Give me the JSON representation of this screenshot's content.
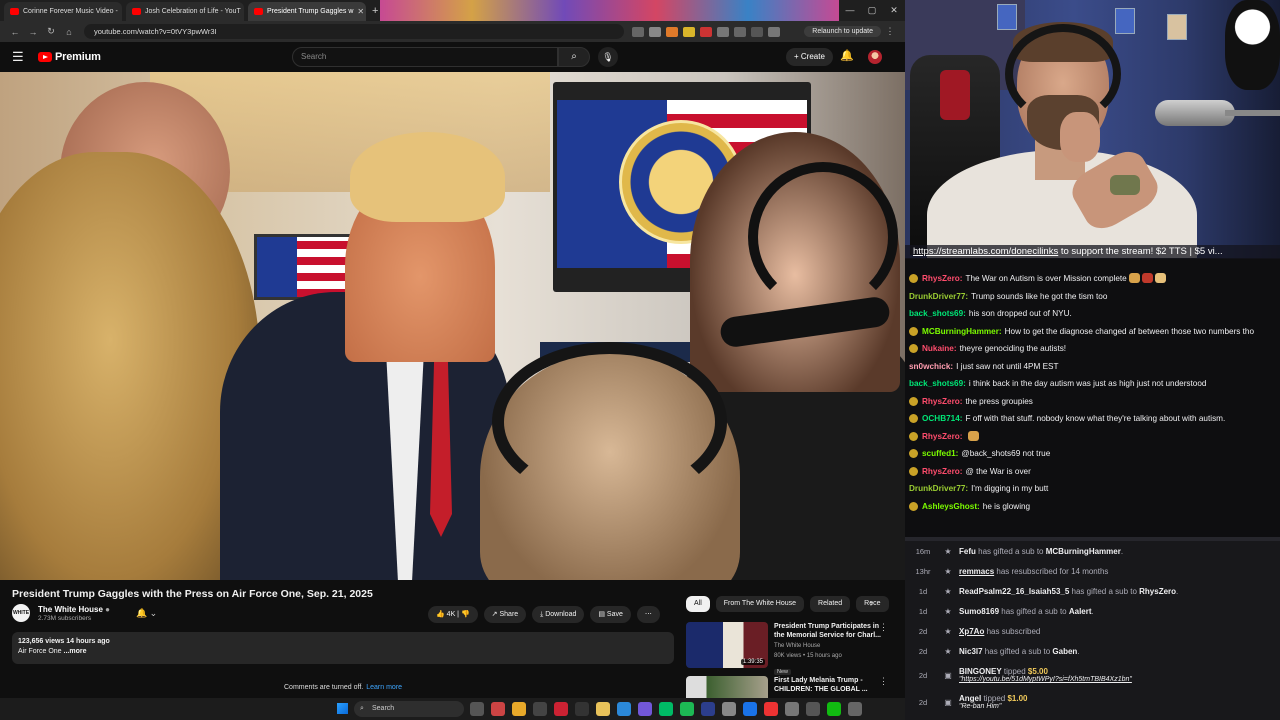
{
  "browser": {
    "tabs": [
      {
        "label": "Corinne Forever Music Video -",
        "active": false
      },
      {
        "label": "Josh Celebration of Life - YouT",
        "active": false
      },
      {
        "label": "President Trump Gaggles w",
        "active": true
      }
    ],
    "url": "youtube.com/watch?v=0tVY3pwWr3I",
    "relaunch_label": "Relaunch to update"
  },
  "youtube": {
    "brand": "Premium",
    "search_placeholder": "Search",
    "create_label": "Create",
    "video_title": "President Trump Gaggles with the Press on Air Force One, Sep. 21, 2025",
    "channel_name": "The White House",
    "channel_avatar_text": "WHITE HOUSE",
    "subscribers": "2.73M subscribers",
    "actions": {
      "likes": "4K",
      "share": "Share",
      "download": "Download",
      "save": "Save"
    },
    "description": {
      "stats": "123,656 views  14 hours ago",
      "text": "Air Force One",
      "more": "...more"
    },
    "comments_off": "Comments are turned off.",
    "learn_more": "Learn more",
    "chips": [
      "All",
      "From The White House",
      "Related",
      "Rece"
    ],
    "related": [
      {
        "title": "President Trump Participates in the Memorial Service for Charl...",
        "channel": "The White House",
        "meta": "80K views • 15 hours ago",
        "badge": "New",
        "duration": "1:39:35"
      },
      {
        "title": "First Lady Melania Trump - CHILDREN: THE GLOBAL ...",
        "channel": "",
        "meta": "",
        "badge": "",
        "duration": ""
      }
    ]
  },
  "stream": {
    "banner_link": "https://streamlabs.com/donecilinks",
    "banner_text": " to support the stream! $2 TTS | $5 vi..."
  },
  "chat": [
    {
      "user": "RhysZero",
      "color": "#ff4d6d",
      "text": "The War on Autism is over Mission complete",
      "badge": "#c9a227",
      "emotes": 3
    },
    {
      "user": "DrunkDriver77",
      "color": "#9acd32",
      "text": "Trump sounds like he got the tism too",
      "badge": "",
      "emotes": 0
    },
    {
      "user": "back_shots69",
      "color": "#00e676",
      "text": "his son dropped out of NYU.",
      "badge": "",
      "emotes": 0
    },
    {
      "user": "MCBurningHammer",
      "color": "#7cfc00",
      "text": "How to get the diagnose changed af between those two numbers tho",
      "badge": "#c9a227",
      "emotes": 0
    },
    {
      "user": "Nukaine",
      "color": "#ff4d6d",
      "text": "theyre genociding the autists!",
      "badge": "#c9a227",
      "emotes": 0
    },
    {
      "user": "sn0wchick",
      "color": "#ff9db0",
      "text": "I just saw not until 4PM EST",
      "badge": "",
      "emotes": 0
    },
    {
      "user": "back_shots69",
      "color": "#00e676",
      "text": "i think back in the day autism was just as high just not understood",
      "badge": "",
      "emotes": 0
    },
    {
      "user": "RhysZero",
      "color": "#ff4d6d",
      "text": "the press groupies",
      "badge": "#c9a227",
      "emotes": 0
    },
    {
      "user": "OCHB714",
      "color": "#00e676",
      "text": "F off with that stuff. nobody know what they're talking about with autism.",
      "badge": "#c9a227",
      "emotes": 0
    },
    {
      "user": "RhysZero",
      "color": "#ff4d6d",
      "text": "",
      "badge": "#c9a227",
      "emotes": 1
    },
    {
      "user": "scuffed1",
      "color": "#7cfc00",
      "text": "@back_shots69 not true",
      "badge": "#c9a227",
      "emotes": 0
    },
    {
      "user": "RhysZero",
      "color": "#ff4d6d",
      "text": "@ the War is over",
      "badge": "#c9a227",
      "emotes": 0
    },
    {
      "user": "DrunkDriver77",
      "color": "#9acd32",
      "text": "I'm digging in my butt",
      "badge": "",
      "emotes": 0
    },
    {
      "user": "AshleysGhost",
      "color": "#7cfc00",
      "text": "he is glowing",
      "badge": "#c9a227",
      "emotes": 0
    }
  ],
  "events": [
    {
      "time": "16m",
      "parts": [
        [
          "b",
          "Fefu"
        ],
        [
          "n",
          " has gifted a sub to "
        ],
        [
          "b",
          "MCBurningHammer"
        ],
        [
          "n",
          "."
        ]
      ],
      "note": ""
    },
    {
      "time": "13hr",
      "parts": [
        [
          "u",
          "remmacs"
        ],
        [
          "n",
          " has resubscribed for 14 months"
        ]
      ],
      "note": ""
    },
    {
      "time": "1d",
      "parts": [
        [
          "b",
          "ReadPsalm22_16_Isaiah53_5"
        ],
        [
          "n",
          " has gifted a sub to "
        ],
        [
          "b",
          "RhysZero"
        ],
        [
          "n",
          "."
        ]
      ],
      "note": ""
    },
    {
      "time": "1d",
      "parts": [
        [
          "b",
          "Sumo8169"
        ],
        [
          "n",
          " has gifted a sub to "
        ],
        [
          "b",
          "Aalert"
        ],
        [
          "n",
          "."
        ]
      ],
      "note": ""
    },
    {
      "time": "2d",
      "parts": [
        [
          "u",
          "Xp7Ao"
        ],
        [
          "n",
          " has subscribed"
        ]
      ],
      "note": ""
    },
    {
      "time": "2d",
      "parts": [
        [
          "b",
          "Nic3l7"
        ],
        [
          "n",
          " has gifted a sub to "
        ],
        [
          "b",
          "Gaben"
        ],
        [
          "n",
          "."
        ]
      ],
      "note": ""
    },
    {
      "time": "2d",
      "parts": [
        [
          "b",
          "BINGONEY"
        ],
        [
          "n",
          " tipped "
        ],
        [
          "m",
          "$5.00"
        ]
      ],
      "note": "\"https://youtu.be/51dMyptWPyI?si=fXh5tmTBIB4Xz1bn\""
    },
    {
      "time": "2d",
      "parts": [
        [
          "b",
          "Angel"
        ],
        [
          "n",
          " tipped "
        ],
        [
          "m",
          "$1.00"
        ]
      ],
      "note": "\"Re-ban Him\""
    }
  ],
  "taskbar": {
    "search_label": "Search"
  },
  "colors": {
    "youtube_red": "#ff0000",
    "chat_bg": "#0e0e10",
    "events_bg": "#18181b",
    "tip_gold": "#f0c95a"
  }
}
